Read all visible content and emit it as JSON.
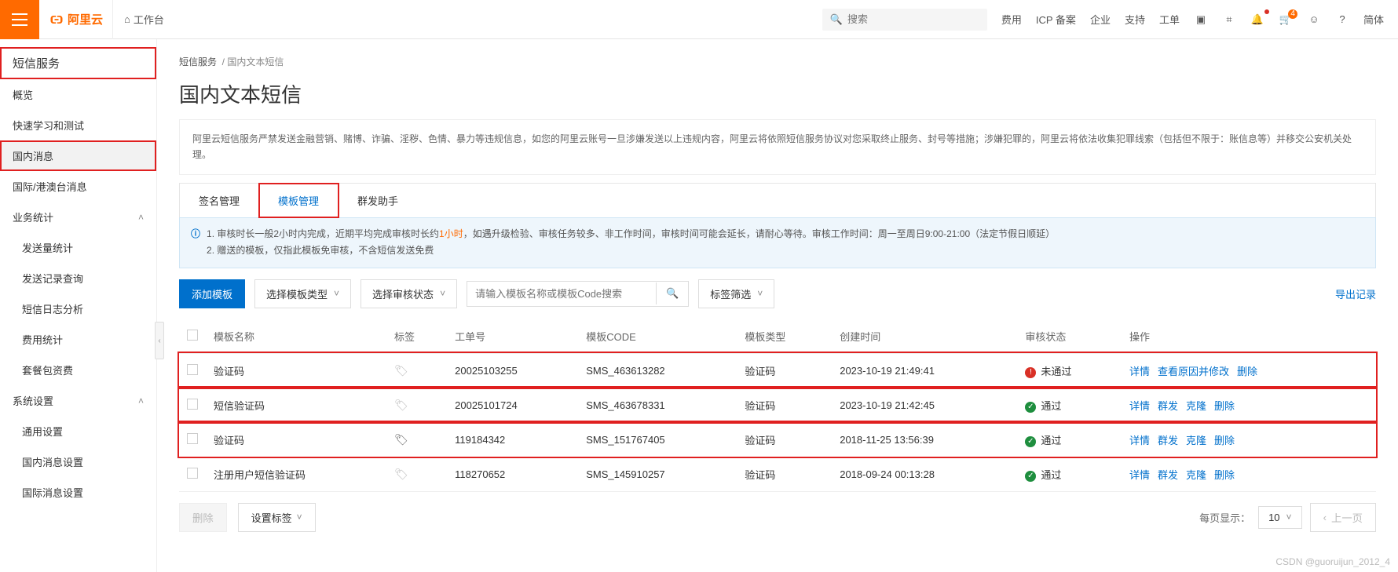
{
  "header": {
    "brand": "阿里云",
    "workbench": "工作台",
    "search_placeholder": "搜索",
    "links": [
      "费用",
      "ICP 备案",
      "企业",
      "支持",
      "工单"
    ],
    "cart_badge": "4",
    "lang": "简体"
  },
  "sidebar": {
    "title": "短信服务",
    "items": [
      "概览",
      "快速学习和测试",
      "国内消息",
      "国际/港澳台消息"
    ],
    "group_biz": "业务统计",
    "biz_children": [
      "发送量统计",
      "发送记录查询",
      "短信日志分析",
      "费用统计",
      "套餐包资费"
    ],
    "group_sys": "系统设置",
    "sys_children": [
      "通用设置",
      "国内消息设置",
      "国际消息设置"
    ]
  },
  "breadcrumb": {
    "a": "短信服务",
    "b": "国内文本短信"
  },
  "page_title": "国内文本短信",
  "notice": "阿里云短信服务严禁发送金融营销、赌博、诈骗、淫秽、色情、暴力等违规信息，如您的阿里云账号一旦涉嫌发送以上违规内容，阿里云将依照短信服务协议对您采取终止服务、封号等措施；涉嫌犯罪的，阿里云将依法收集犯罪线索（包括但不限于：账信息等）并移交公安机关处理。",
  "tabs": [
    "签名管理",
    "模板管理",
    "群发助手"
  ],
  "info": {
    "line1a": "1. 审核时长一般2小时内完成，近期平均完成审核时长约",
    "line1hl": "1小时",
    "line1b": "，如遇升级检验、审核任务较多、非工作时间，审核时间可能会延长，请耐心等待。审核工作时间：周一至周日9:00-21:00（法定节假日顺延）",
    "line2": "2. 赠送的模板，仅指此模板免审核，不含短信发送免费"
  },
  "toolbar": {
    "add": "添加模板",
    "select_type": "选择模板类型",
    "select_status": "选择审核状态",
    "search_placeholder": "请输入模板名称或模板Code搜索",
    "tag_filter": "标签筛选",
    "export": "导出记录"
  },
  "columns": [
    "模板名称",
    "标签",
    "工单号",
    "模板CODE",
    "模板类型",
    "创建时间",
    "审核状态",
    "操作"
  ],
  "status_labels": {
    "pass": "通过",
    "fail": "未通过"
  },
  "actions": {
    "detail": "详情",
    "reason": "查看原因并修改",
    "group": "群发",
    "clone": "克隆",
    "delete": "删除"
  },
  "rows": [
    {
      "name": "验证码",
      "ticket": "20025103255",
      "code": "SMS_463613282",
      "type": "验证码",
      "time": "2023-10-19 21:49:41",
      "status": "fail",
      "ops": [
        "detail",
        "reason",
        "delete"
      ]
    },
    {
      "name": "短信验证码",
      "ticket": "20025101724",
      "code": "SMS_463678331",
      "type": "验证码",
      "time": "2023-10-19 21:42:45",
      "status": "pass",
      "ops": [
        "detail",
        "group",
        "clone",
        "delete"
      ]
    },
    {
      "name": "验证码",
      "ticket": "119184342",
      "code": "SMS_151767405",
      "type": "验证码",
      "time": "2018-11-25 13:56:39",
      "status": "pass",
      "ops": [
        "detail",
        "group",
        "clone",
        "delete"
      ],
      "tag_dark": true
    },
    {
      "name": "注册用户短信验证码",
      "ticket": "118270652",
      "code": "SMS_145910257",
      "type": "验证码",
      "time": "2018-09-24 00:13:28",
      "status": "pass",
      "ops": [
        "detail",
        "group",
        "clone",
        "delete"
      ]
    }
  ],
  "footer": {
    "delete": "删除",
    "set_tag": "设置标签",
    "page_size_label": "每页显示：",
    "page_size": "10",
    "prev": "上一页"
  },
  "watermark": "CSDN @guoruijun_2012_4"
}
